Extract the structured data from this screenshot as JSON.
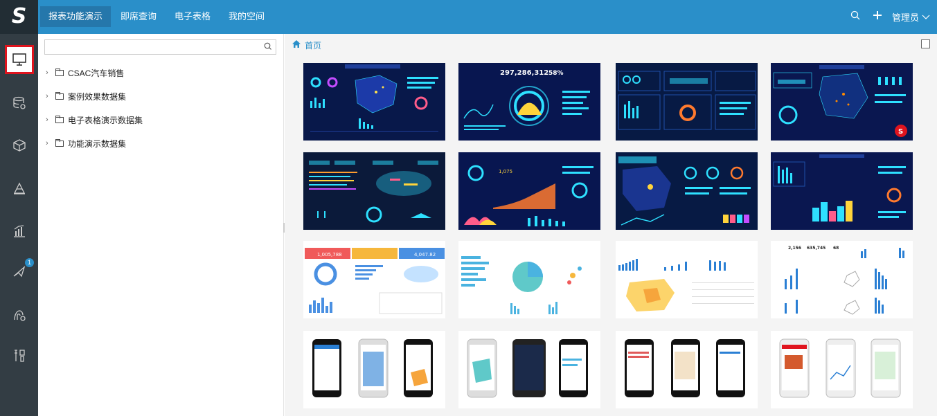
{
  "app": {
    "logo": "S",
    "nav_tabs": [
      {
        "label": "报表功能演示",
        "active": true
      },
      {
        "label": "即席查询",
        "active": false
      },
      {
        "label": "电子表格",
        "active": false
      },
      {
        "label": "我的空间",
        "active": false
      }
    ],
    "user_label": "管理员",
    "icons": {
      "search": "search-icon",
      "add": "plus-icon",
      "user_menu": "chevron-down-icon"
    }
  },
  "sidebar": {
    "items": [
      {
        "name": "dashboard",
        "icon": "monitor-icon",
        "active": true
      },
      {
        "name": "data",
        "icon": "database-icon"
      },
      {
        "name": "model",
        "icon": "cube-icon"
      },
      {
        "name": "analysis",
        "icon": "layers-icon"
      },
      {
        "name": "chart",
        "icon": "bar-chart-icon"
      },
      {
        "name": "publish",
        "icon": "send-icon",
        "badge": "1"
      },
      {
        "name": "user",
        "icon": "user-settings-icon"
      },
      {
        "name": "tools",
        "icon": "tools-icon"
      }
    ]
  },
  "tree": {
    "search_placeholder": "",
    "items": [
      {
        "label": "CSAC汽车销售"
      },
      {
        "label": "案例效果数据集"
      },
      {
        "label": "电子表格演示数据集"
      },
      {
        "label": "功能演示数据集"
      }
    ]
  },
  "main": {
    "breadcrumb": "首页",
    "colors": {
      "accent": "#2a8fc9",
      "sidebar_bg": "#333d44",
      "active_border": "#e0141e",
      "dark_card": "#0a1a4a"
    },
    "cards": [
      {
        "theme": "dark",
        "kind": "map-dashboard"
      },
      {
        "theme": "dark",
        "kind": "ring-dashboard",
        "big_number": "297,286,312",
        "percent": "58%"
      },
      {
        "theme": "dark",
        "kind": "grid-dashboard"
      },
      {
        "theme": "dark",
        "kind": "map-dashboard-2"
      },
      {
        "theme": "dark",
        "kind": "wordcloud-dashboard"
      },
      {
        "theme": "dark",
        "kind": "area-dashboard",
        "big_number": "1,075"
      },
      {
        "theme": "dark",
        "kind": "map-rings-dashboard"
      },
      {
        "theme": "dark",
        "kind": "bar-dashboard"
      },
      {
        "theme": "light",
        "kind": "colorful-dashboard",
        "values": [
          "1,005,788",
          "4,047.82"
        ]
      },
      {
        "theme": "light",
        "kind": "pie-dashboard"
      },
      {
        "theme": "light",
        "kind": "map-bars-dashboard"
      },
      {
        "theme": "light",
        "kind": "kpi-dashboard",
        "values": [
          "2,156",
          "635,745",
          "68"
        ]
      },
      {
        "theme": "light",
        "kind": "mobile-1"
      },
      {
        "theme": "light",
        "kind": "mobile-2"
      },
      {
        "theme": "light",
        "kind": "mobile-3"
      },
      {
        "theme": "light",
        "kind": "mobile-4"
      }
    ]
  }
}
